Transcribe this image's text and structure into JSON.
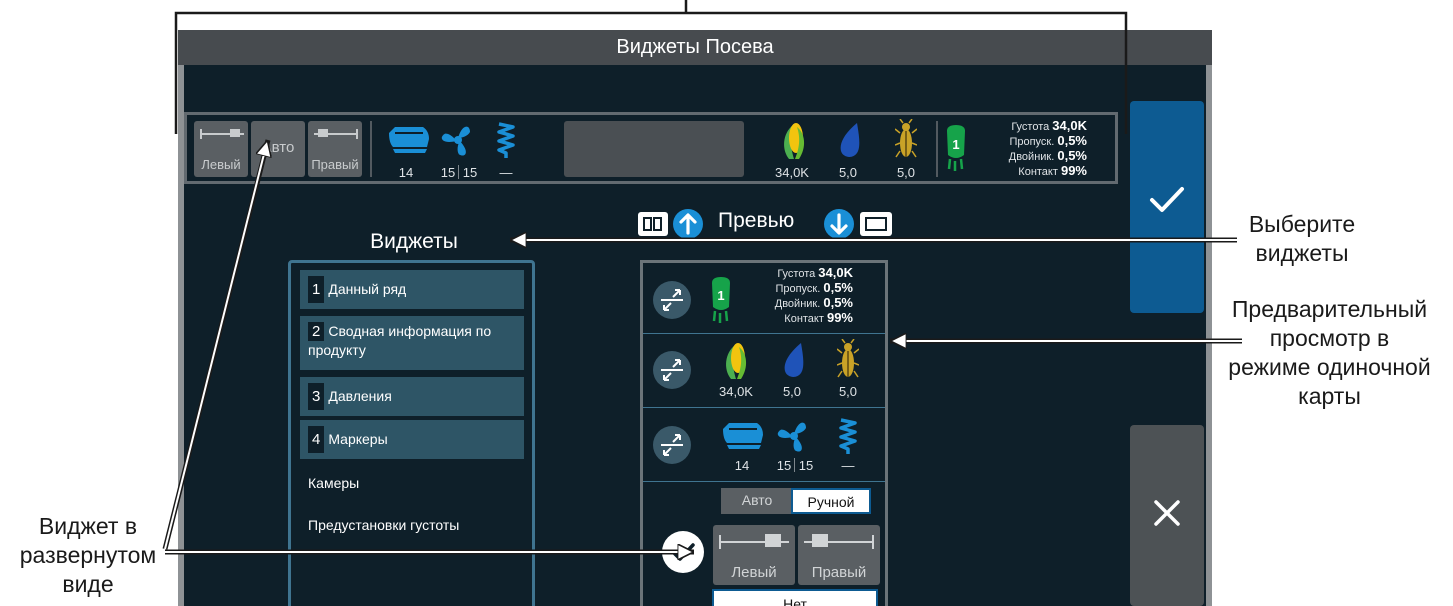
{
  "window": {
    "title": "Виджеты Посева"
  },
  "strip": {
    "left_label": "Левый",
    "auto_label": "Авто",
    "right_label": "Правый",
    "v1": "14",
    "v2a": "15",
    "v2b": "15",
    "v3": "—",
    "seed": "34,0K",
    "drop": "5,0",
    "bug": "5,0",
    "row_num": "1",
    "stats": [
      {
        "label": "Густота",
        "value": "34,0K"
      },
      {
        "label": "Пропуск.",
        "value": "0,5%"
      },
      {
        "label": "Двойник.",
        "value": "0,5%"
      },
      {
        "label": "Контакт",
        "value": "99%"
      }
    ]
  },
  "widgets": {
    "title": "Виджеты",
    "items": [
      {
        "num": "1",
        "label": "Данный ряд"
      },
      {
        "num": "2",
        "label": "Сводная информация по продукту"
      },
      {
        "num": "3",
        "label": "Давления"
      },
      {
        "num": "4",
        "label": "Маркеры"
      }
    ],
    "plain": [
      "Камеры",
      "Предустановки густоты"
    ]
  },
  "preview": {
    "title": "Превью",
    "stats": [
      {
        "label": "Густота",
        "value": "34,0K"
      },
      {
        "label": "Пропуск.",
        "value": "0,5%"
      },
      {
        "label": "Двойник.",
        "value": "0,5%"
      },
      {
        "label": "Контакт",
        "value": "99%"
      }
    ],
    "row_num": "1",
    "seed": "34,0K",
    "drop": "5,0",
    "bug": "5,0",
    "v1": "14",
    "v2a": "15",
    "v2b": "15",
    "v3": "—",
    "auto": "Авто",
    "manual": "Ручной",
    "left": "Левый",
    "right": "Правый",
    "none": "Нет"
  },
  "callouts": {
    "select": "Выберите\nвиджеты",
    "single": "Предварительный\nпросмотр в\nрежиме одиночной\nкарты",
    "expanded": "Виджет в\nразвернутом\nвиде"
  },
  "colors": {
    "screen": "#0e1f29",
    "accent_blue": "#0d5b92",
    "icon_blue": "#1a8fd6",
    "seed_green": "#16a34a",
    "corn_yellow": "#f2c40f"
  }
}
